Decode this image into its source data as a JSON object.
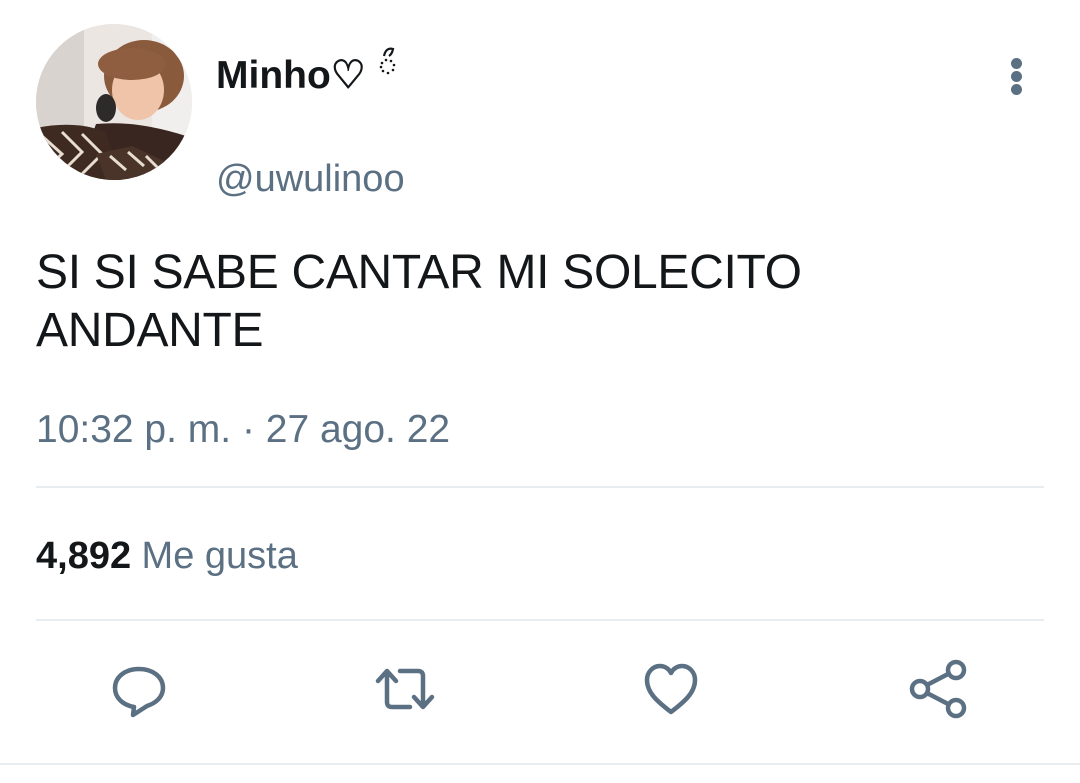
{
  "tweet": {
    "author": {
      "display_name": "Minho♡",
      "handle": "@uwulinoo",
      "avatar": "profile-photo"
    },
    "text": "SI SI SABE CANTAR MI SOLECITO ANDANTE",
    "timestamp": "10:32 p. m. · 27 ago. 22",
    "stats": {
      "likes_count": "4,892",
      "likes_label": "Me gusta"
    },
    "actions": [
      "reply-icon",
      "retweet-icon",
      "like-icon",
      "share-icon"
    ]
  },
  "colors": {
    "primary_text": "#14171a",
    "secondary_text": "#5b7083",
    "divider": "#e6ecf0",
    "background": "#ffffff"
  }
}
